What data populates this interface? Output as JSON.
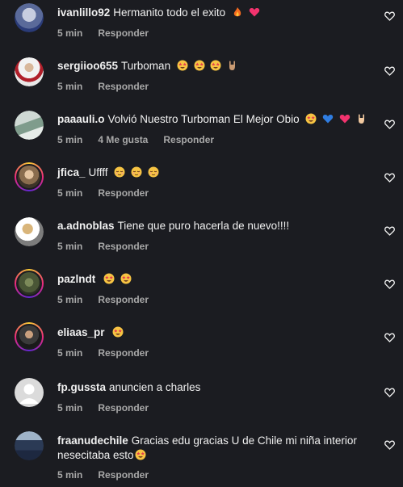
{
  "comments": [
    {
      "username": "ivanlillo92",
      "text": "Hermanito todo el exito",
      "time": "5 min",
      "likes": "",
      "reply": "Responder",
      "emojis": [
        "fire-emoji",
        "heart-emoji"
      ],
      "avatar": "photo",
      "story": false
    },
    {
      "username": "sergiioo655",
      "text": "Turboman",
      "time": "5 min",
      "likes": "",
      "reply": "Responder",
      "emojis": [
        "star-struck-emoji",
        "star-struck-emoji",
        "star-struck-emoji",
        "rock-hand-emoji"
      ],
      "avatar": "photo",
      "story": false
    },
    {
      "username": "paaauli.o",
      "text": "Volvió Nuestro Turboman El Mejor Obio",
      "time": "5 min",
      "likes": "4 Me gusta",
      "reply": "Responder",
      "emojis": [
        "star-struck-emoji",
        "blue-heart-emoji",
        "heart-emoji",
        "rock-hand-emoji"
      ],
      "avatar": "photo",
      "story": false
    },
    {
      "username": "jfica_",
      "text": "Uffff",
      "time": "5 min",
      "likes": "",
      "reply": "Responder",
      "emojis": [
        "relieved-emoji",
        "relieved-emoji",
        "relieved-emoji"
      ],
      "avatar": "photo",
      "story": true
    },
    {
      "username": "a.adnoblas",
      "text": "Tiene que puro hacerla de nuevo!!!!",
      "time": "5 min",
      "likes": "",
      "reply": "Responder",
      "emojis": [],
      "avatar": "photo",
      "story": false
    },
    {
      "username": "pazlndt",
      "text": "",
      "time": "5 min",
      "likes": "",
      "reply": "Responder",
      "emojis": [
        "star-struck-emoji",
        "star-struck-emoji"
      ],
      "avatar": "photo",
      "story": true
    },
    {
      "username": "eliaas_pr",
      "text": "",
      "time": "5 min",
      "likes": "",
      "reply": "Responder",
      "emojis": [
        "star-struck-emoji"
      ],
      "avatar": "photo",
      "story": true
    },
    {
      "username": "fp.gussta",
      "text": "anuncien a charles",
      "time": "5 min",
      "likes": "",
      "reply": "Responder",
      "emojis": [],
      "avatar": "default",
      "story": false
    },
    {
      "username": "fraanudechile",
      "text": "Gracias edu gracias U de Chile mi niña interior",
      "text2": "nesecitaba esto",
      "time": "5 min",
      "likes": "",
      "reply": "Responder",
      "emojis": [
        "star-struck-emoji"
      ],
      "avatar": "photo",
      "story": false
    }
  ],
  "colors": {
    "background": "#1b1c21",
    "text": "#f0f0f0",
    "meta": "#a8a8a8",
    "story_ring": "#ee2a7b"
  }
}
